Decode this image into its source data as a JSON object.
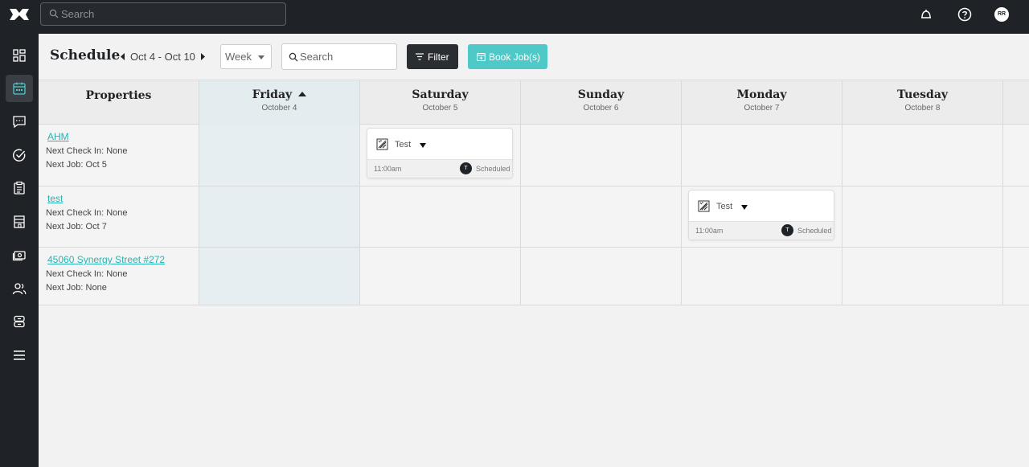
{
  "topbar": {
    "search_placeholder": "Search",
    "avatar_initials": "RR",
    "icons": [
      "logo-icon",
      "bell-icon",
      "help-icon"
    ]
  },
  "sidebar": {
    "items": [
      {
        "name": "dashboard",
        "active": false
      },
      {
        "name": "schedule",
        "active": true
      },
      {
        "name": "messages",
        "active": false
      },
      {
        "name": "tasks",
        "active": false
      },
      {
        "name": "reports",
        "active": false
      },
      {
        "name": "properties",
        "active": false
      },
      {
        "name": "payments",
        "active": false
      },
      {
        "name": "team",
        "active": false
      },
      {
        "name": "inventory",
        "active": false
      },
      {
        "name": "menu",
        "active": false
      }
    ]
  },
  "header": {
    "title": "Schedule",
    "date_range": "Oct 4 - Oct 10",
    "view_select": "Week",
    "search_placeholder": "Search",
    "filter_label": "Filter",
    "book_label": "Book Job(s)"
  },
  "grid": {
    "properties_header": "Properties",
    "days": [
      {
        "day": "Friday",
        "date": "October 4",
        "today": true,
        "sorted": true
      },
      {
        "day": "Saturday",
        "date": "October 5",
        "today": false
      },
      {
        "day": "Sunday",
        "date": "October 6",
        "today": false
      },
      {
        "day": "Monday",
        "date": "October 7",
        "today": false
      },
      {
        "day": "Tuesday",
        "date": "October 8",
        "today": false
      }
    ],
    "rows": [
      {
        "name": "AHM",
        "next_checkin": "Next Check In: None",
        "next_job": "Next Job: Oct 5"
      },
      {
        "name": "test",
        "next_checkin": "Next Check In: None",
        "next_job": "Next Job: Oct 7"
      },
      {
        "name": "45060 Synergy Street #272",
        "next_checkin": "Next Check In: None",
        "next_job": "Next Job: None"
      }
    ],
    "jobs": [
      {
        "row": 0,
        "day": "Saturday",
        "name": "Test",
        "time": "11:00am",
        "assignee": "T",
        "status": "Scheduled"
      },
      {
        "row": 1,
        "day": "Monday",
        "name": "Test",
        "time": "11:00am",
        "assignee": "T",
        "status": "Scheduled"
      }
    ]
  },
  "colors": {
    "topbar": "#1f2226",
    "accent": "#4fc8c8",
    "link": "#2ab3b3",
    "today_column": "#e6eef1"
  }
}
